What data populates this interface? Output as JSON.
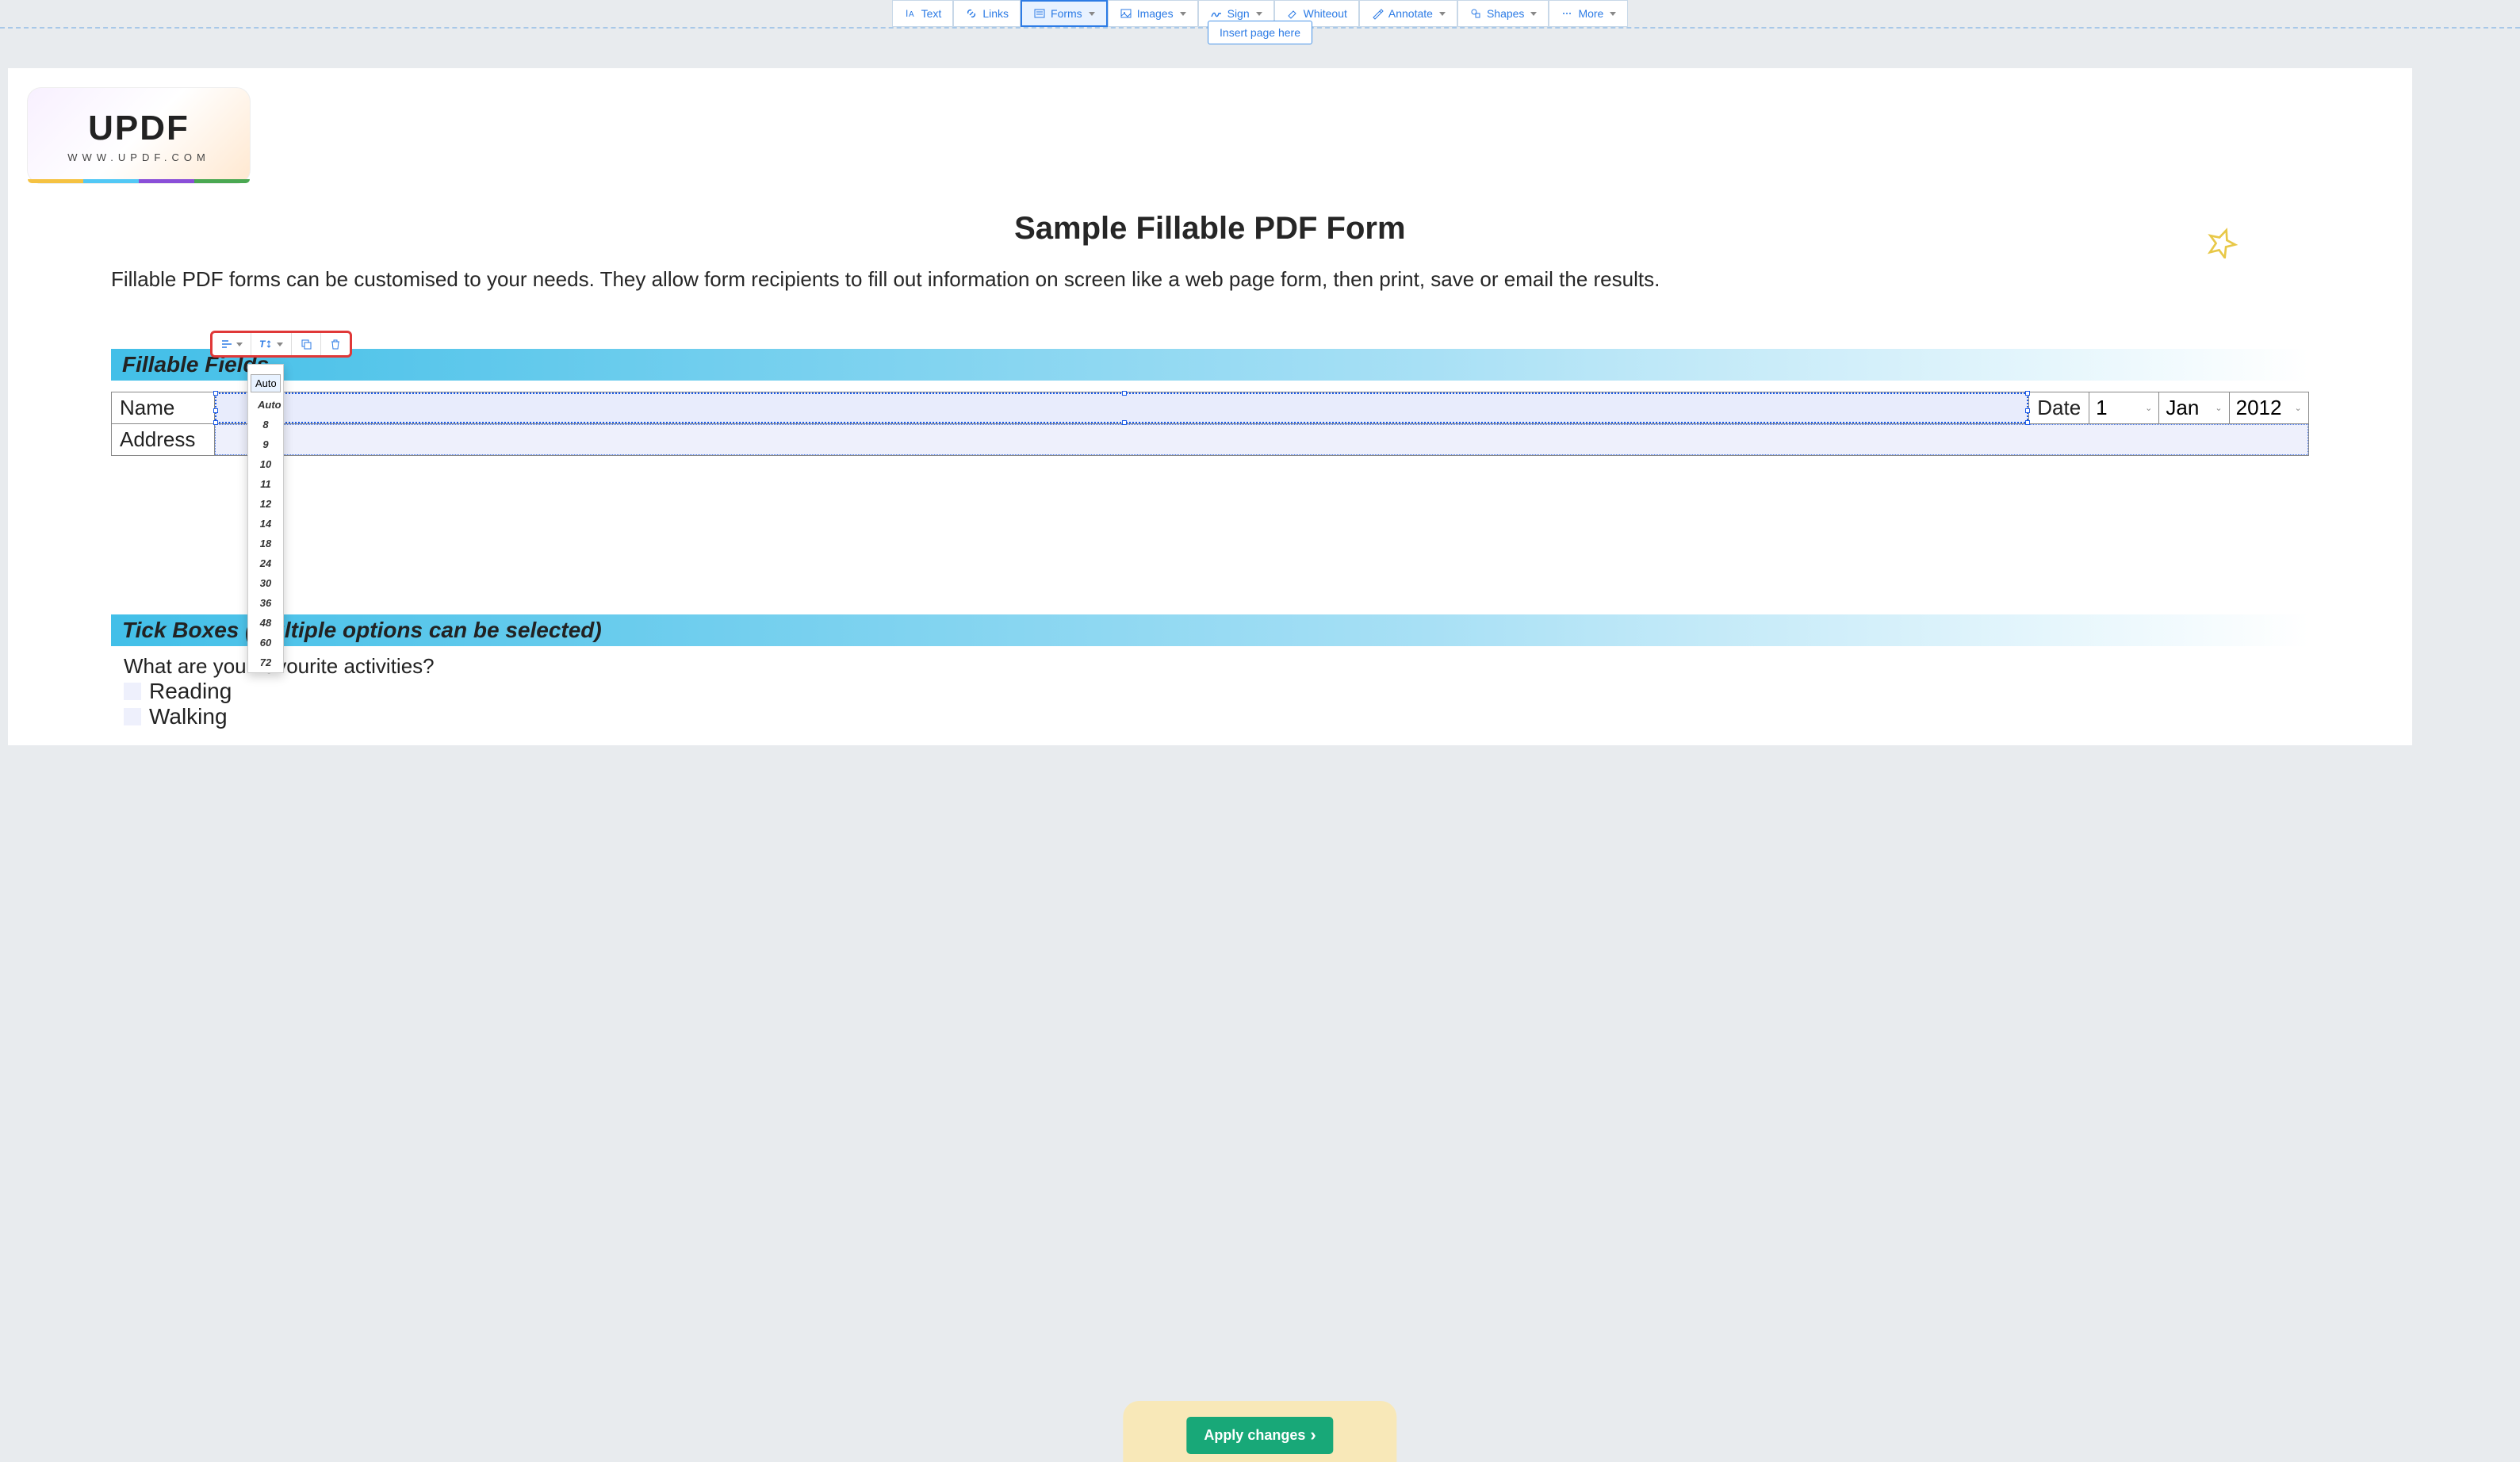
{
  "toolbar": {
    "text": "Text",
    "links": "Links",
    "forms": "Forms",
    "images": "Images",
    "sign": "Sign",
    "whiteout": "Whiteout",
    "annotate": "Annotate",
    "shapes": "Shapes",
    "more": "More"
  },
  "insert_page": "Insert page here",
  "logo": {
    "name": "UPDF",
    "url": "WWW.UPDF.COM"
  },
  "page_title": "Sample Fillable PDF Form",
  "intro": "Fillable PDF forms can be customised to your needs. They allow form recipients to fill out information on screen like a web page form, then print, save or email the results.",
  "section_fillable": "Fillable Fields",
  "labels": {
    "name": "Name",
    "address": "Address",
    "date": "Date"
  },
  "date_values": {
    "day": "1",
    "month": "Jan",
    "year": "2012"
  },
  "field_toolbar": {
    "align_label": "align",
    "fontsize_label": "font size",
    "copy_label": "copy",
    "delete_label": "delete"
  },
  "size_dropdown": {
    "input_value": "Auto",
    "options": [
      "Auto",
      "8",
      "9",
      "10",
      "11",
      "12",
      "14",
      "18",
      "24",
      "30",
      "36",
      "48",
      "60",
      "72"
    ]
  },
  "section_tickboxes": "Tick Boxes (Multiple options can be selected)",
  "question": "What are your favourite activities?",
  "activities": {
    "reading": "Reading",
    "walking": "Walking"
  },
  "apply_button": "Apply changes",
  "colors": {
    "accent": "#2c7be5",
    "highlight_border": "#e03838",
    "apply_button_bg": "#18a878",
    "section_header_start": "#42bfe8"
  }
}
